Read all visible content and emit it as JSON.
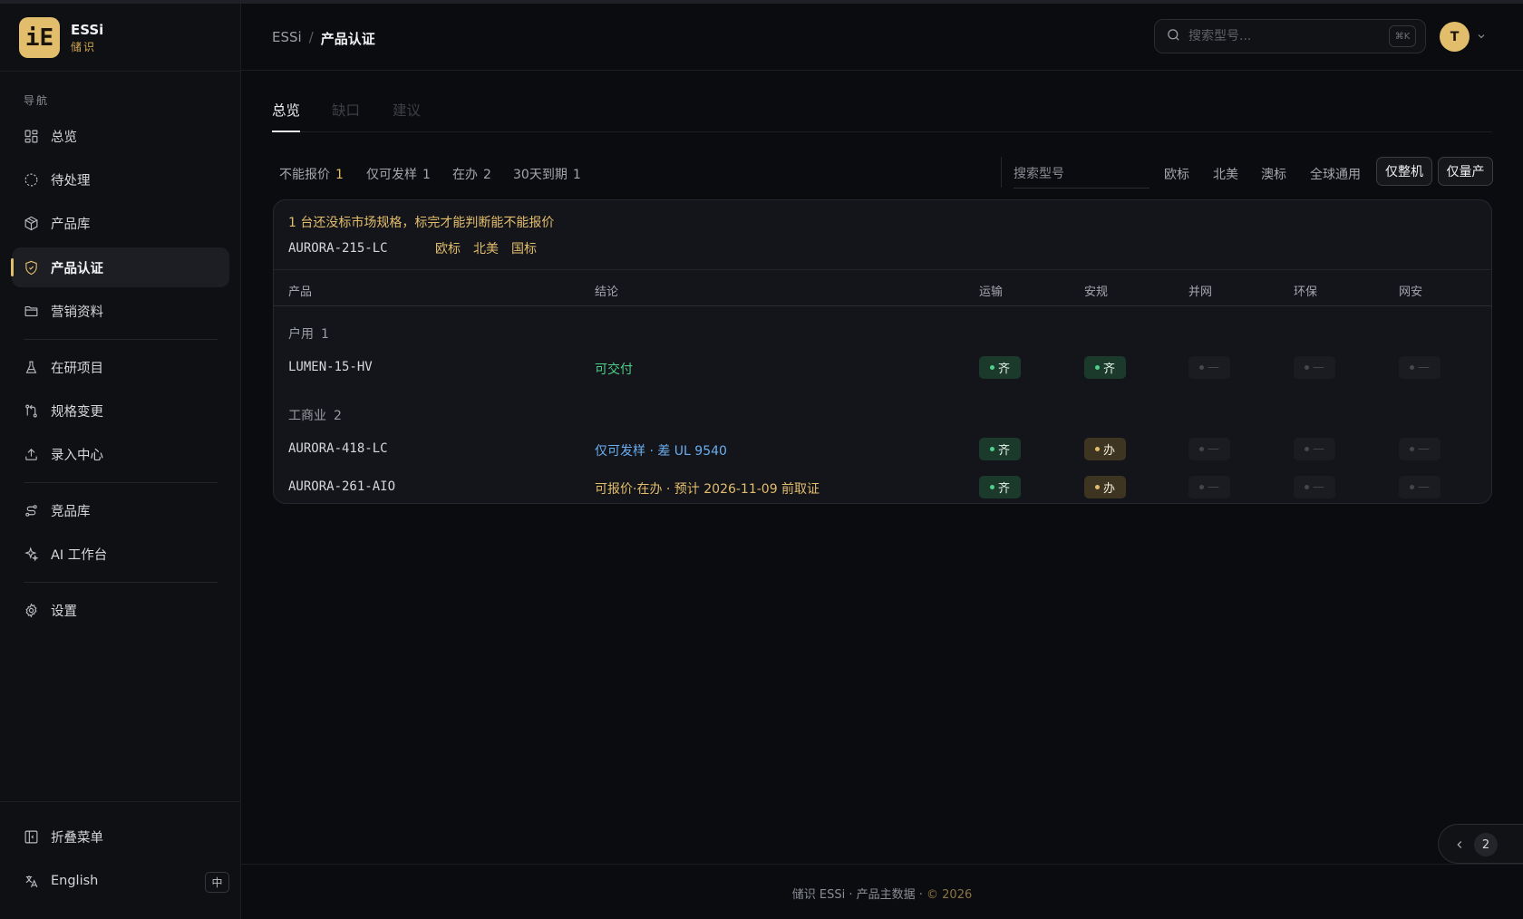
{
  "brand": {
    "name": "ESSi",
    "sub": "储识",
    "logo_glyph": "iE"
  },
  "nav": {
    "title": "导航",
    "items": [
      {
        "label": "总览",
        "icon": "grid-icon"
      },
      {
        "label": "待处理",
        "icon": "dashed-circle-icon"
      },
      {
        "label": "产品库",
        "icon": "box-icon"
      },
      {
        "label": "产品认证",
        "icon": "shield-check-icon",
        "active": true
      },
      {
        "label": "营销资料",
        "icon": "folder-icon"
      },
      {
        "label": "在研项目",
        "icon": "flask-icon"
      },
      {
        "label": "规格变更",
        "icon": "git-compare-icon"
      },
      {
        "label": "录入中心",
        "icon": "upload-icon"
      },
      {
        "label": "竞品库",
        "icon": "route-icon"
      },
      {
        "label": "AI 工作台",
        "icon": "sparkle-icon"
      },
      {
        "label": "设置",
        "icon": "gear-icon"
      }
    ],
    "collapse_label": "折叠菜单",
    "language_label": "English",
    "language_toggle": "中"
  },
  "header": {
    "breadcrumb_root": "ESSi",
    "breadcrumb_sep": "/",
    "breadcrumb_current": "产品认证",
    "search_placeholder": "搜索型号...",
    "search_shortcut": "⌘K",
    "avatar_initial": "T"
  },
  "tabs": [
    {
      "label": "总览",
      "active": true
    },
    {
      "label": "缺口",
      "active": false
    },
    {
      "label": "建议",
      "active": false
    }
  ],
  "stats": [
    {
      "label": "不能报价",
      "count": "1",
      "accent": true
    },
    {
      "label": "仅可发样",
      "count": "1",
      "accent": false
    },
    {
      "label": "在办",
      "count": "2",
      "accent": false
    },
    {
      "label": "30天到期",
      "count": "1",
      "accent": false
    }
  ],
  "filters": {
    "model_search_placeholder": "搜索型号",
    "markets": [
      "欧标",
      "北美",
      "澳标",
      "全球通用"
    ],
    "toggles": [
      "仅整机",
      "仅量产"
    ]
  },
  "warning": {
    "text": "1 台还没标市场规格，标完才能判断能不能报价",
    "model": "AURORA-215-LC",
    "markets": [
      "欧标",
      "北美",
      "国标"
    ]
  },
  "table": {
    "headers": {
      "product": "产品",
      "conclusion": "结论",
      "transport": "运输",
      "safety": "安规",
      "grid": "并网",
      "eco": "环保",
      "cyber": "网安"
    },
    "groups": [
      {
        "label": "户用",
        "count": "1",
        "rows": [
          {
            "model": "LUMEN-15-HV",
            "conclusion": "可交付",
            "conclusion_color": "#4fcf8a",
            "badges": [
              {
                "status": "ok",
                "text": "齐"
              },
              {
                "status": "ok",
                "text": "齐"
              },
              {
                "status": "na",
                "text": "—"
              },
              {
                "status": "na",
                "text": "—"
              },
              {
                "status": "na",
                "text": "—"
              }
            ]
          }
        ]
      },
      {
        "label": "工商业",
        "count": "2",
        "rows": [
          {
            "model": "AURORA-418-LC",
            "conclusion": "仅可发样 · 差 UL 9540",
            "conclusion_color": "#6aaef0",
            "badges": [
              {
                "status": "ok",
                "text": "齐"
              },
              {
                "status": "wip",
                "text": "办"
              },
              {
                "status": "na",
                "text": "—"
              },
              {
                "status": "na",
                "text": "—"
              },
              {
                "status": "na",
                "text": "—"
              }
            ]
          },
          {
            "model": "AURORA-261-AIO",
            "conclusion": "可报价·在办 · 预计 2026-11-09 前取证",
            "conclusion_color": "#e2bd6c",
            "badges": [
              {
                "status": "ok",
                "text": "齐"
              },
              {
                "status": "wip",
                "text": "办"
              },
              {
                "status": "na",
                "text": "—"
              },
              {
                "status": "na",
                "text": "—"
              },
              {
                "status": "na",
                "text": "—"
              }
            ]
          }
        ]
      }
    ]
  },
  "footer": {
    "text": "储识 ESSi · 产品主数据 · ",
    "copyright": "© 2026"
  },
  "pager": {
    "page": "2"
  },
  "colors": {
    "accent": "#e2bd6c",
    "ok": "#4fcf8a",
    "info": "#6aaef0",
    "background": "#0b0c0f"
  }
}
